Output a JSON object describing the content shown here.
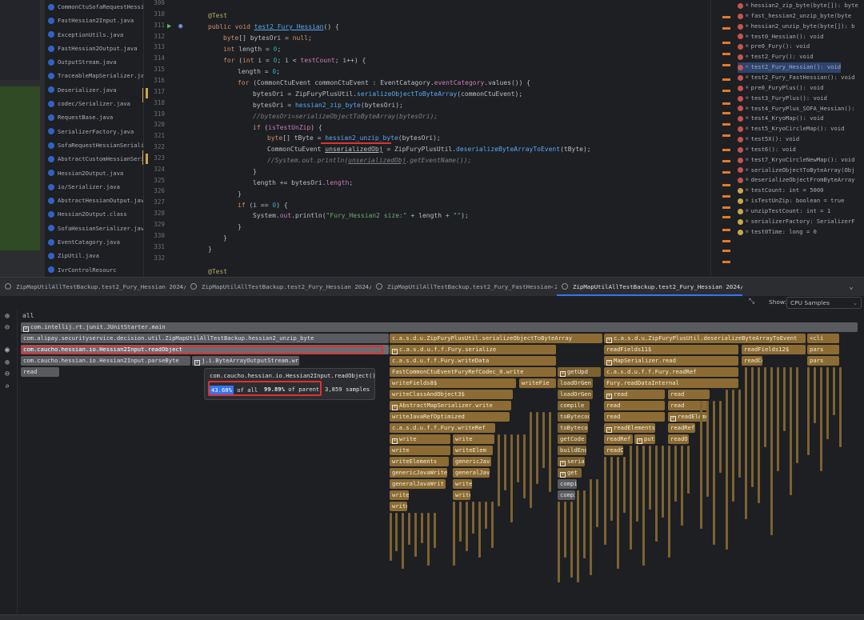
{
  "project": {
    "items": [
      "CommonCtuSofaRequestHessian",
      "FastHessian2Input.java",
      "ExceptionUtils.java",
      "FastHessian2Output.java",
      "OutputStream.java",
      "TraceableMapSerializer.java",
      "Deserializer.java",
      "codec/Serializer.java",
      "RequestBase.java",
      "SerializerFactory.java",
      "SofaRequestHessianSerializ",
      "AbstractCustomHessianSerial",
      "Hessian2Output.java",
      "io/Serializer.java",
      "AbstractHessianOutput.java",
      "Hessian2Output.class",
      "SofaHessianSerializer.java",
      "EventCatagory.java",
      "ZipUtil.java",
      "IvrControlResourc"
    ]
  },
  "editor": {
    "line_numbers": [
      "309",
      "310",
      "311",
      "312",
      "313",
      "314",
      "315",
      "316",
      "317",
      "318",
      "319",
      "320",
      "321",
      "322",
      "323",
      "324",
      "325",
      "326",
      "327",
      "328",
      "329",
      "330",
      "331",
      "332"
    ],
    "lines": {
      "l310": "@Test",
      "l311_kw": "public void ",
      "l311_fn": "test2_Fury_Hessian",
      "l311_rest": "() {",
      "l312_a": "byte",
      "l312_b": "[] bytesOri = ",
      "l312_c": "null",
      "l312_d": ";",
      "l313_a": "int",
      "l313_b": " length = ",
      "l313_c": "0",
      "l313_d": ";",
      "l314_a": "for",
      "l314_b": " (",
      "l314_c": "int",
      "l314_d": " i = ",
      "l314_e": "0",
      "l314_f": "; i < ",
      "l314_g": "testCount",
      "l314_h": "; i++) {",
      "l315_a": "length = ",
      "l315_b": "0",
      "l315_c": ";",
      "l316_a": "for",
      "l316_b": " (CommonCtuEvent commonCtuEvent : EventCatagory.",
      "l316_c": "eventCategory",
      "l316_d": ".values()) {",
      "l317_a": "bytesOri = ZipFuryPlusUtil.",
      "l317_b": "serializeObjectToByteArray",
      "l317_c": "(commonCtuEvent);",
      "l318_a": "bytesOri = ",
      "l318_b": "hessian2_zip_byte",
      "l318_c": "(bytesOri);",
      "l319": "//bytesOri=serializeObjectToByteArray(bytesOri);",
      "l320_a": "if",
      "l320_b": " (",
      "l320_c": "isTestUnZip",
      "l320_d": ") {",
      "l321_a": "byte",
      "l321_b": "[] tByte = ",
      "l321_c": "hessian2_unzip_byte",
      "l321_d": "(bytesOri);",
      "l322_a": "CommonCtuEvent ",
      "l322_b": "unserializedObj",
      "l322_c": " = ZipFuryPlusUtil.",
      "l322_d": "deserializeByteArrayToEvent",
      "l322_e": "(tByte);",
      "l323_a": "//System.out.println(",
      "l323_b": "unserializedObj",
      "l323_c": ".getEventName());",
      "l324": "}",
      "l325_a": "length += bytesOri.",
      "l325_b": "length",
      "l325_c": ";",
      "l326": "}",
      "l327_a": "if",
      "l327_b": " (i == ",
      "l327_c": "0",
      "l327_d": ") {",
      "l328_a": "System.",
      "l328_b": "out",
      "l328_c": ".println(",
      "l328_d": "\"Fury_Hessian2 size:\"",
      "l328_e": " + length + ",
      "l328_f": "\"\"",
      "l328_g": ");",
      "l329": "}",
      "l330": "}",
      "l331": "}",
      "l333": "@Test"
    }
  },
  "structure": {
    "items": [
      {
        "label": "hessian2_zip_byte(byte[]): byte",
        "kind": "m"
      },
      {
        "label": "fast_hessian2_unzip_byte(byte",
        "kind": "m"
      },
      {
        "label": "hessian2_unzip_byte(byte[]): b",
        "kind": "m"
      },
      {
        "label": "test0_Hessian(): void",
        "kind": "m"
      },
      {
        "label": "pre0_Fury(): void",
        "kind": "m"
      },
      {
        "label": "test2_Fury(): void",
        "kind": "m"
      },
      {
        "label": "test2_Fury_Hessian(): void",
        "kind": "m"
      },
      {
        "label": "test2_Fury_FastHessian(): void",
        "kind": "m"
      },
      {
        "label": "pre0_FuryPlus(): void",
        "kind": "m"
      },
      {
        "label": "test3_FuryPlus(): void",
        "kind": "m"
      },
      {
        "label": "test4_FuryPlus_SOFA_Hessian():",
        "kind": "m"
      },
      {
        "label": "test4_KryoMap(): void",
        "kind": "m"
      },
      {
        "label": "test5_KryoCircleMap(): void",
        "kind": "m"
      },
      {
        "label": "test5X(): void",
        "kind": "m"
      },
      {
        "label": "test6(): void",
        "kind": "m"
      },
      {
        "label": "test7_KryoCircleNewMap(): void",
        "kind": "m"
      },
      {
        "label": "serializeObjectToByteArray(Obj",
        "kind": "m"
      },
      {
        "label": "deserializeObjectFromByteArray",
        "kind": "m"
      },
      {
        "label": "testCount: int = 5000",
        "kind": "f"
      },
      {
        "label": "isTestUnZip: boolean = true",
        "kind": "f"
      },
      {
        "label": "unzipTestCount: int = 1",
        "kind": "f"
      },
      {
        "label": "serializerFactory: SerializerF",
        "kind": "f"
      },
      {
        "label": "test0Time: long = 0",
        "kind": "f"
      }
    ]
  },
  "tabs": [
    {
      "label": "ZipMapUtilAllTestBackup.test2_Fury_Hessian 2024/...",
      "active": false
    },
    {
      "label": "ZipMapUtilAllTestBackup.test2_Fury_Hessian 2024/...",
      "active": false
    },
    {
      "label": "ZipMapUtilAllTestBackup.test2_Fury_FastHessian 2...",
      "active": false
    },
    {
      "label": "ZipMapUtilAllTestBackup.test2_Fury_Hessian 2024/...",
      "active": true
    }
  ],
  "profiler": {
    "show_label": "Show:",
    "show_value": "CPU Samples",
    "root_label": "all",
    "frames": {
      "f1": "com.intellij.rt.junit.JUnitStarter.main",
      "f2": "com.alipay.securityservice.decision.util.ZipMapUtilAllTestBackup.hessian2_unzip_byte",
      "f3": "com.caucho.hessian.io.Hessian2Input.readObject",
      "f4": "com.caucho.hessian.io.Hessian2Input.parseByte",
      "f5": "j.i.ByteArrayOutputStream.write",
      "f6": "read",
      "c1": "c.a.s.d.u.ZipFuryPlusUtil.serializeObjectToByteArray",
      "c2": "c.a.s.d.u.f.f.Fury.serialize",
      "c3": "c.a.s.d.u.f.f.Fury.writeData",
      "c4": "FastCommonCtuEventFuryRefCodec_0.write",
      "c5": "writeFields8$",
      "c5b": "writeFie",
      "c6": "writeClassAndObject3$",
      "c7": "AbstractMapSerializer.write",
      "c8": "writeJavaRefOptimized",
      "c9": "c.a.s.d.u.f.f.Fury.writeRef",
      "c10a": "write",
      "c10b": "write",
      "c11a": "write",
      "c11b": "writeElem",
      "c12a": "writeElements",
      "c12b": "genericJav",
      "c13a": "genericJavaWrite",
      "c13b": "generalJav",
      "c14a": "generalJavaWrit",
      "c14b": "write",
      "c15a": "write",
      "c15b": "write",
      "c16": "write",
      "d1": "getUpd",
      "d2": "loadOrGen",
      "d3": "loadOrGen",
      "d4": "compile",
      "d5": "toBytecod",
      "d6": "toBytecod",
      "d7": "getCode",
      "d8": "buildEnc",
      "d9": "serial",
      "d10": "get",
      "d11": "compi",
      "d12": "compi",
      "e1": "c.a.s.d.u.ZipFuryPlusUtil.deserializeByteArrayToEvent",
      "e2": "readFields11$",
      "e2b": "readFields12$",
      "e3": "MapSerializer.read",
      "e3b": "readCo",
      "e4": "c.a.s.d.u.f.f.Fury.readRef",
      "e5": "Fury.readDataInternal",
      "e6a": "read",
      "e6b": "read",
      "e7a": "read",
      "e7b": "read",
      "e8a": "read",
      "e8b": "readElemen",
      "e9a": "readElements",
      "e9b": "readRef",
      "e10a": "readRef",
      "e10b": "put",
      "e10c": "readO",
      "e11": "readC",
      "g1": "<cli",
      "g2": "pars",
      "g3": "pars"
    },
    "tooltip": {
      "title": "com.caucho.hessian.io.Hessian2Input.readObject()",
      "pct_all": "43.68%",
      "pct_all_suffix": " of all",
      "pct_parent": "99.89%",
      "pct_parent_suffix": " of parent",
      "samples": "3,859",
      "samples_suffix": " samples"
    }
  },
  "colors": {
    "frame_gray": "#5a5b5f",
    "frame_brown": "#8c6c34",
    "highlight_red": "#e03131",
    "accent_blue": "#3574f0"
  }
}
